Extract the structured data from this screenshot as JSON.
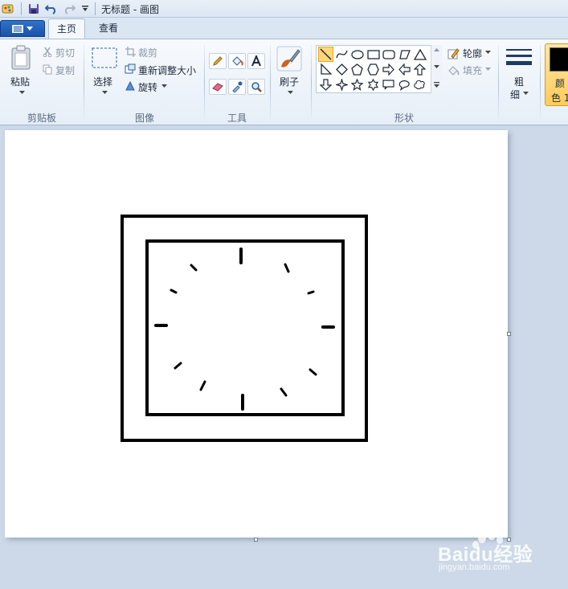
{
  "window": {
    "title": "无标题 - 画图"
  },
  "quick_access": {
    "icons": [
      "paint-app-icon",
      "save-icon",
      "undo-icon",
      "redo-icon",
      "customize-dropdown-icon"
    ]
  },
  "tabs": [
    {
      "label": "主页",
      "active": true
    },
    {
      "label": "查看",
      "active": false
    }
  ],
  "ribbon": {
    "clipboard": {
      "paste": "粘贴",
      "cut": "剪切",
      "copy": "复制",
      "group": "剪贴板"
    },
    "image": {
      "select": "选择",
      "crop": "裁剪",
      "resize": "重新调整大小",
      "rotate": "旋转",
      "group": "图像"
    },
    "tools": {
      "group": "工具",
      "items": [
        "pencil",
        "fill",
        "text",
        "eraser",
        "color-picker",
        "magnifier"
      ]
    },
    "brushes": {
      "label": "刷子"
    },
    "shapes": {
      "outline": "轮廓",
      "fill": "填充",
      "group": "形状"
    },
    "size": {
      "label_top": "粗",
      "label_bottom": "细"
    },
    "colors": {
      "label_top": "颜",
      "label_bottom": "色 1",
      "color1": "#000000"
    }
  },
  "watermark": {
    "text": "Baidu经验",
    "sub": "jingyan.baidu.com"
  }
}
